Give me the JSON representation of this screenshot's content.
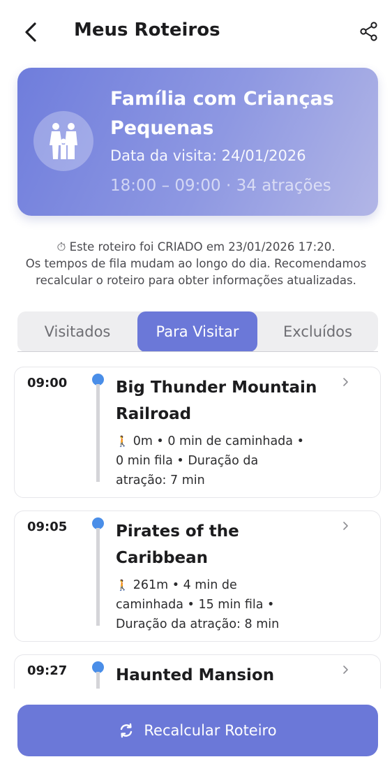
{
  "header": {
    "title": "Meus Roteiros",
    "back_icon": "chevron-left-icon",
    "share_icon": "share-icon"
  },
  "itinerary": {
    "title": "Família com Crianças Pequenas",
    "visit_date": "Data da visita: 24/01/2026",
    "meta": "18:00 – 09:00 · 34 atrações",
    "avatar_icon": "family-icon",
    "colors": {
      "gradient_start": "#6f7ddc",
      "gradient_end": "#b2b6e6"
    }
  },
  "notice": {
    "icon": "stopwatch-icon",
    "line1": "⏱ Este roteiro foi CRIADO em 23/01/2026 17:20.",
    "line2": "Os tempos de fila mudam ao longo do dia. Recomendamos",
    "line3": "recalcular o roteiro para obter informações atualizadas."
  },
  "tabs": {
    "items": [
      {
        "label": "Visitados",
        "active": false
      },
      {
        "label": "Para Visitar",
        "active": true
      },
      {
        "label": "Excluídos",
        "active": false
      }
    ],
    "accent": "#6b78d8"
  },
  "attractions": [
    {
      "time": "09:00",
      "name_line1": "Big Thunder Mountain",
      "name_line2": "Railroad",
      "detail_line1": "0m • 0 min de caminhada •",
      "detail_line2": "0 min fila • Duração da",
      "detail_line3": "atração: 7 min"
    },
    {
      "time": "09:05",
      "name_line1": "Pirates of the",
      "name_line2": "Caribbean",
      "detail_line1": "261m • 4 min de",
      "detail_line2": "caminhada • 15 min fila •",
      "detail_line3": "Duração da atração: 8 min"
    },
    {
      "time": "09:27",
      "name_line1": "Haunted Mansion"
    }
  ],
  "walk_icon": "🚶",
  "recalc_button": {
    "label": "Recalcular Roteiro",
    "icon": "refresh-icon"
  }
}
